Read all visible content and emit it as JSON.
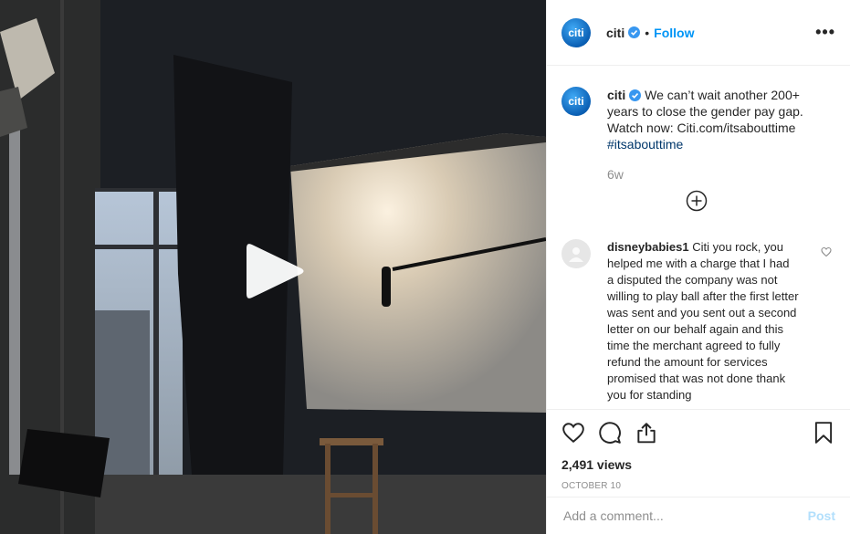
{
  "header": {
    "username": "citi",
    "avatar_text": "citi",
    "dot": "•",
    "follow_label": "Follow",
    "more_label": "•••"
  },
  "caption": {
    "username": "citi",
    "text": " We can’t wait another 200+ years to close the gender pay gap. Watch now: Citi.com/itsabouttime ",
    "hashtag": "#itsabouttime",
    "time": "6w"
  },
  "comment": {
    "username": "disneybabies1",
    "text": " Citi you rock, you helped me with a charge that I had a disputed the company was not willing to play ball after the first letter was sent and you sent out a second letter on our behalf again and this time the merchant agreed to fully refund the amount for services promised that was not done thank you for standing"
  },
  "stats": {
    "views": "2,491 views",
    "date": "OCTOBER 10"
  },
  "add_comment": {
    "placeholder": "Add a comment...",
    "post_label": "Post"
  },
  "icons": [
    "play-icon",
    "verified-badge-icon",
    "more-options-icon",
    "load-more-plus-icon",
    "comment-like-heart-icon",
    "like-heart-icon",
    "comment-bubble-icon",
    "share-icon",
    "bookmark-icon"
  ],
  "colors": {
    "link_blue": "#0095f6",
    "hashtag": "#00376b",
    "muted": "#8e8e8e",
    "post_disabled": "#b2dffc"
  }
}
